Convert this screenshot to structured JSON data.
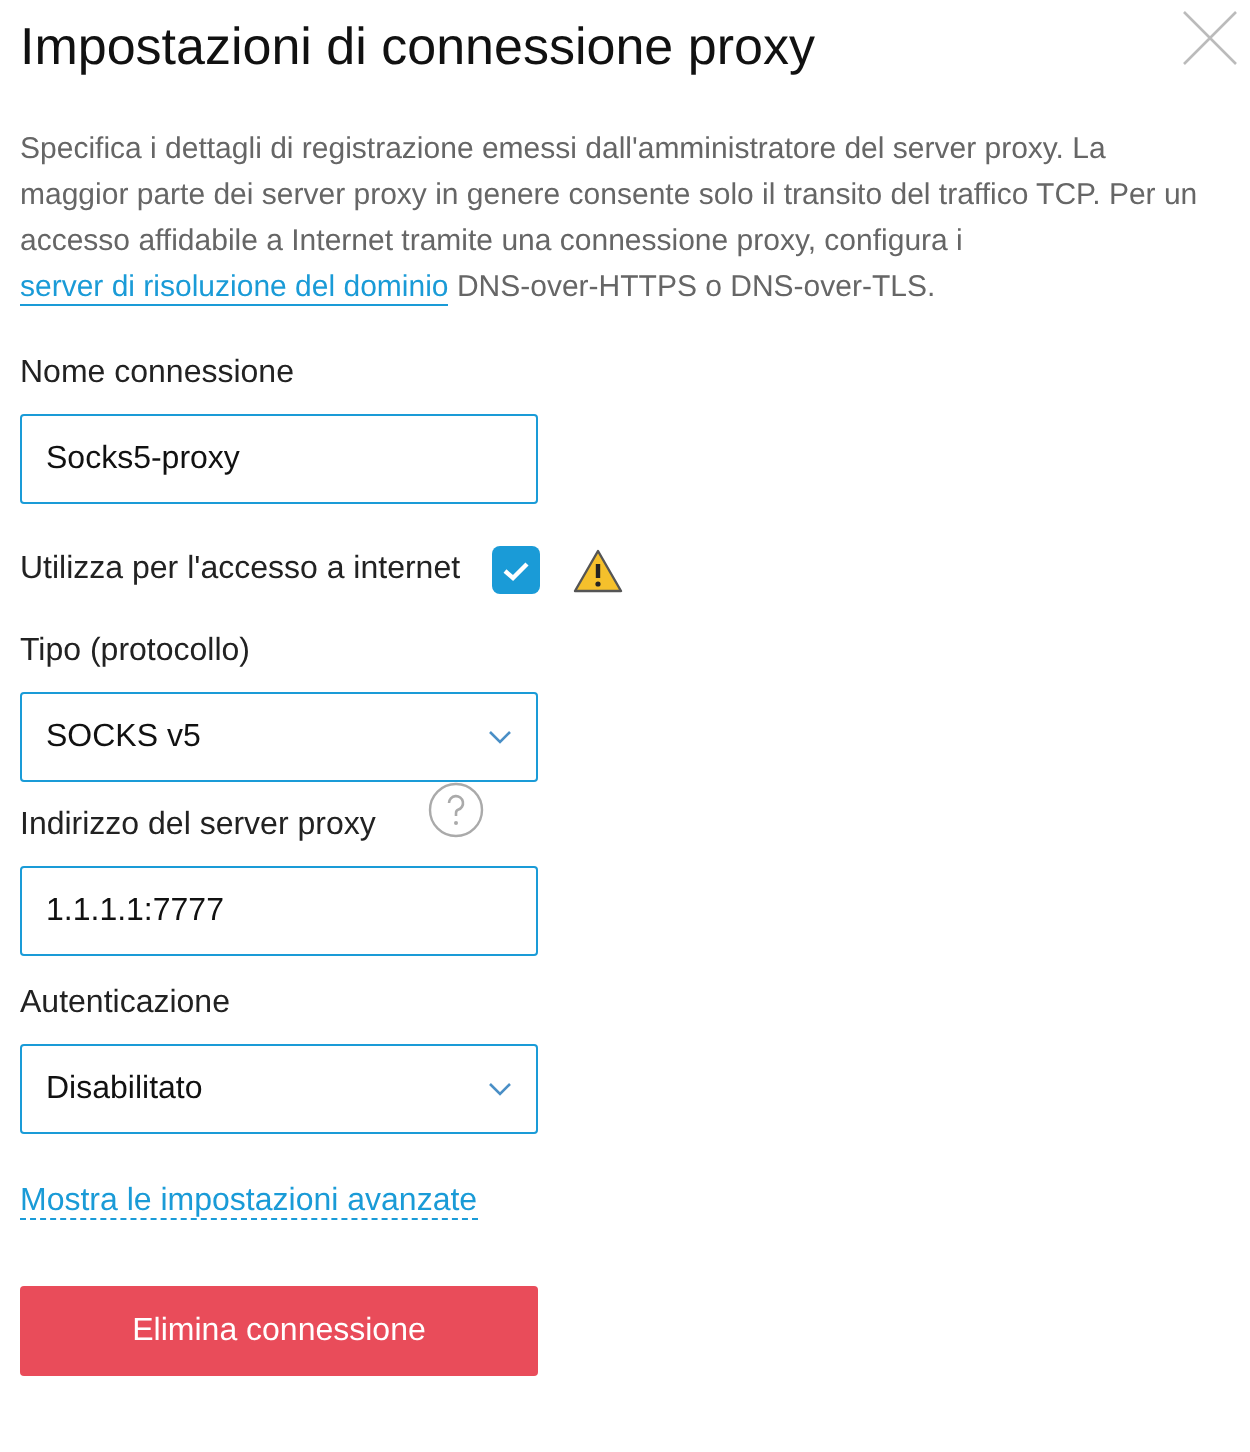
{
  "title": "Impostazioni di connessione proxy",
  "description": {
    "before": "Specifica i dettagli di registrazione emessi dall'amministratore del server proxy. La maggior parte dei server proxy in genere consente solo il transito del traffico TCP. Per un accesso affidabile a Internet tramite una connessione proxy, configura i",
    "link": "server di risoluzione del dominio",
    "after": "DNS-over-HTTPS o DNS-over-TLS."
  },
  "fields": [
    {
      "kind": "text",
      "label": "Nome connessione",
      "value": "Socks5-proxy",
      "has_help": false
    },
    {
      "kind": "checkbox",
      "label": "Utilizza per l'accesso a internet",
      "checked": true,
      "warning": true
    },
    {
      "kind": "select",
      "label": "Tipo (protocollo)",
      "value": "SOCKS v5",
      "has_help": false
    },
    {
      "kind": "text",
      "label": "Indirizzo del server proxy",
      "value": "1.1.1.1:7777",
      "has_help": true
    },
    {
      "kind": "select",
      "label": "Autenticazione",
      "value": "Disabilitato",
      "has_help": false
    }
  ],
  "advanced_link": "Mostra le impostazioni avanzate",
  "delete_button": "Elimina connessione"
}
